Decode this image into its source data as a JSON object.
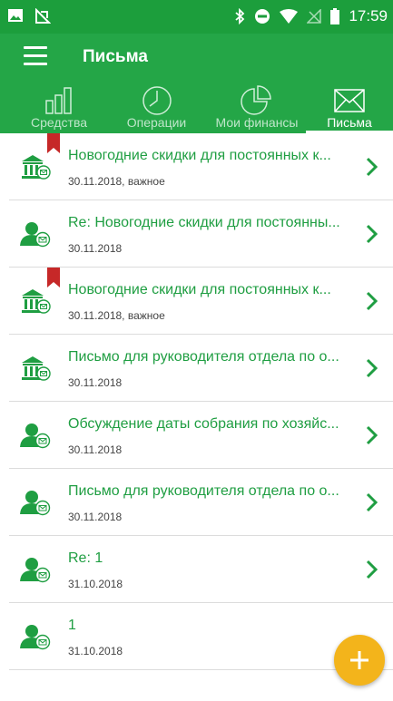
{
  "status_bar": {
    "time": "17:59"
  },
  "toolbar": {
    "title": "Письма",
    "menu_icon": "hamburger-menu-icon"
  },
  "tabs": [
    {
      "label": "Средства",
      "icon": "bar-chart-icon",
      "active": false
    },
    {
      "label": "Операции",
      "icon": "clock-icon",
      "active": false
    },
    {
      "label": "Мои финансы",
      "icon": "pie-chart-icon",
      "active": false
    },
    {
      "label": "Письма",
      "icon": "envelope-icon",
      "active": true
    }
  ],
  "letters": [
    {
      "subject": "Новогодние скидки для постоянных к...",
      "meta": "30.11.2018, важное",
      "sender_icon": "bank-mail-icon",
      "important": true
    },
    {
      "subject": "Re: Новогодние скидки для постоянны...",
      "meta": "30.11.2018",
      "sender_icon": "person-mail-icon",
      "important": false
    },
    {
      "subject": "Новогодние скидки для постоянных к...",
      "meta": "30.11.2018, важное",
      "sender_icon": "bank-mail-icon",
      "important": true
    },
    {
      "subject": "Письмо для руководителя отдела по о...",
      "meta": "30.11.2018",
      "sender_icon": "bank-mail-icon",
      "important": false
    },
    {
      "subject": "Обсуждение даты собрания по хозяйс...",
      "meta": "30.11.2018",
      "sender_icon": "person-mail-icon",
      "important": false
    },
    {
      "subject": "Письмо для руководителя отдела по о...",
      "meta": "30.11.2018",
      "sender_icon": "person-mail-icon",
      "important": false
    },
    {
      "subject": "Re: 1",
      "meta": "31.10.2018",
      "sender_icon": "person-mail-icon",
      "important": false
    },
    {
      "subject": "1",
      "meta": "31.10.2018",
      "sender_icon": "person-mail-icon",
      "important": false
    }
  ],
  "fab": {
    "icon": "plus-icon"
  },
  "colors": {
    "primary": "#24a647",
    "status_bar": "#1c9e3c",
    "link_green": "#1f9e42",
    "bookmark_red": "#c62828",
    "fab_yellow": "#f3b41b"
  }
}
